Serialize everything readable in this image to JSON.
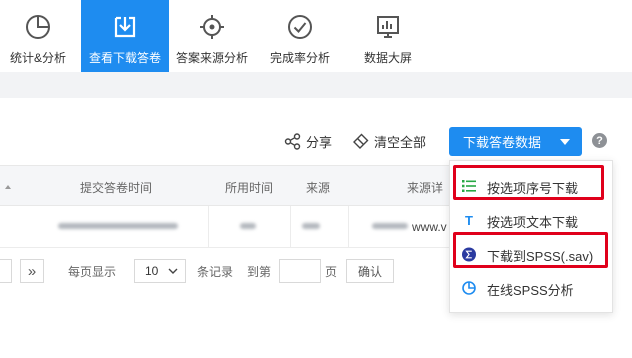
{
  "toolbar": {
    "items": [
      {
        "label": "统计&分析",
        "icon": "pie-chart-icon"
      },
      {
        "label": "查看下载答卷",
        "icon": "download-icon",
        "active": true
      },
      {
        "label": "答案来源分析",
        "icon": "crosshair-icon"
      },
      {
        "label": "完成率分析",
        "icon": "check-circle-icon"
      },
      {
        "label": "数据大屏",
        "icon": "monitor-chart-icon"
      }
    ]
  },
  "actions": {
    "share_label": "分享",
    "clear_label": "清空全部",
    "download_label": "下载答卷数据",
    "help_glyph": "?"
  },
  "table": {
    "headers": [
      "提交答卷时间",
      "所用时间",
      "来源",
      "来源详"
    ],
    "row": {
      "source_detail_visible": "www.v"
    }
  },
  "pagination": {
    "first_glyph": "»",
    "per_page_label": "每页显示",
    "per_page_value": "10",
    "records_label": "条记录",
    "goto_label": "到第",
    "page_label": "页",
    "confirm_label": "确认"
  },
  "download_menu": {
    "items": [
      {
        "label": "按选项序号下载",
        "icon": "list-icon",
        "highlighted": true
      },
      {
        "label": "按选项文本下载",
        "icon": "text-T-icon",
        "highlighted": false
      },
      {
        "label": "下载到SPSS(.sav)",
        "icon": "spss-sigma-icon",
        "highlighted": true
      },
      {
        "label": "在线SPSS分析",
        "icon": "pie-analysis-icon",
        "highlighted": false
      }
    ]
  },
  "colors": {
    "accent": "#1e8cf0",
    "highlight_border": "#e0001b"
  }
}
